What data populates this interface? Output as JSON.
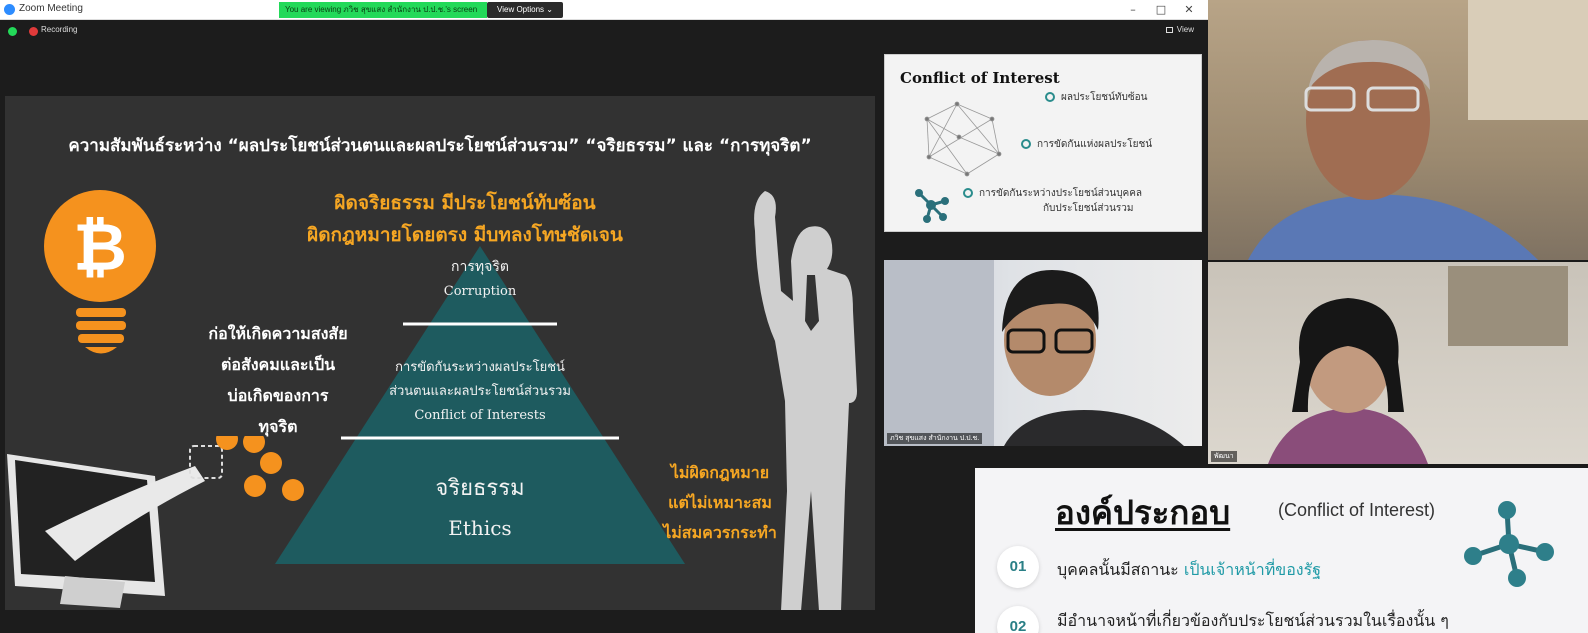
{
  "window": {
    "title": "Zoom Meeting",
    "viewing_banner": "You are viewing ภวิช สุขแสง สำนักงาน ป.ป.ช.'s screen",
    "view_options_label": "View Options",
    "minimize": "–",
    "maximize": "□",
    "close": "✕"
  },
  "status": {
    "recording_label": "Recording",
    "view_label": "View"
  },
  "slide": {
    "title": "ความสัมพันธ์ระหว่าง “ผลประโยชน์ส่วนตนและผลประโยชน์ส่วนรวม” “จริยธรรม” และ “การทุจริต”",
    "headline_lines": [
      "ผิดจริยธรรม มีประโยชน์ทับซ้อน",
      "ผิดกฎหมายโดยตรง มีบทลงโทษชัดเจน"
    ],
    "pyramid": {
      "top_th": "การทุจริต",
      "top_en": "Corruption",
      "middle_th_1": "การขัดกันระหว่างผลประโยชน์",
      "middle_th_2": "ส่วนตนและผลประโยชน์ส่วนรวม",
      "middle_en": "Conflict of Interests",
      "bottom_th": "จริยธรรม",
      "bottom_en": "Ethics"
    },
    "left_text_lines": [
      "ก่อให้เกิดความสงสัย",
      "ต่อสังคมและเป็น",
      "บ่อเกิดของการ",
      "ทุจริต"
    ],
    "right_text_lines": [
      "ไม่ผิดกฎหมาย",
      "แต่ไม่เหมาะสม",
      "ไม่สมควรกระทำ"
    ],
    "colors": {
      "bg": "#323232",
      "teal": "#1e5b5f",
      "orange": "#f5a623"
    }
  },
  "mini_slide": {
    "title": "Conflict of Interest",
    "items": [
      "ผลประโยชน์ทับซ้อน",
      "การขัดกันแห่งผลประโยชน์",
      "การขัดกันระหว่างประโยชน์ส่วนบุคคล",
      "กับประโยชน์ส่วนรวม"
    ]
  },
  "participants": {
    "presenter_label": "ภวิช สุขแสง สำนักงาน ป.ป.ช.",
    "participant_3_label": "พัฒนา"
  },
  "bottom_slide": {
    "heading": "องค์ประกอบ",
    "subheading": "(Conflict of Interest)",
    "items": [
      {
        "num": "01",
        "text": "บุคคลนั้นมีสถานะ ",
        "highlight": "เป็นเจ้าหน้าที่ของรัฐ"
      },
      {
        "num": "02",
        "text": "มีอำนาจหน้าที่เกี่ยวข้องกับประโยชน์ส่วนรวมในเรื่องนั้น ๆ",
        "highlight": ""
      }
    ]
  }
}
